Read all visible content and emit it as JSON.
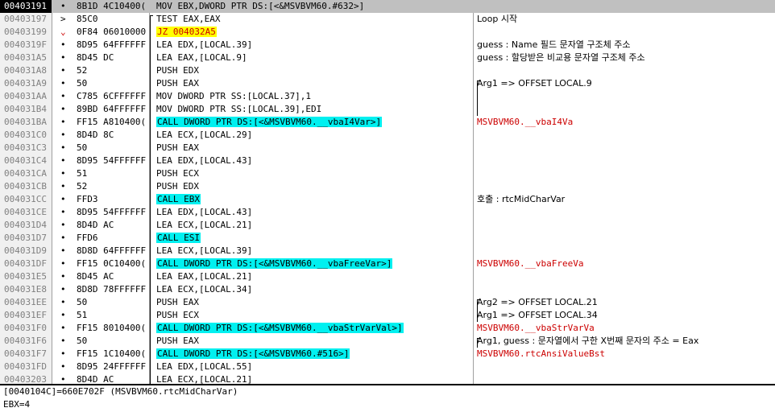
{
  "colors": {
    "highlight_call": "#00f0f0",
    "highlight_jump": "#ffff00",
    "jump_text": "#cc0000",
    "comment_red": "#cc0000",
    "selected_row": "#c0c0c0"
  },
  "rows": [
    {
      "addr": "00403191",
      "mark": "•",
      "bytes": "8B1D 4C10400(",
      "dis": "MOV EBX,DWORD PTR DS:[<&MSVBVM60.#632>]",
      "hl": "",
      "cmt": "",
      "cmt_red": false,
      "selected": true
    },
    {
      "addr": "00403197",
      "mark": ">",
      "bytes": "85C0",
      "dis": "TEST EAX,EAX",
      "hl": "",
      "cmt": "Loop 시작",
      "cmt_red": false
    },
    {
      "addr": "00403199",
      "mark": "⌄",
      "bytes": "0F84 06010000",
      "dis": "JZ 004032A5",
      "hl": "jump",
      "cmt": "",
      "cmt_red": false
    },
    {
      "addr": "0040319F",
      "mark": "•",
      "bytes": "8D95 64FFFFFF",
      "dis": "LEA EDX,[LOCAL.39]",
      "hl": "",
      "cmt": "guess : Name 필드 문자열 구조체 주소",
      "cmt_red": false
    },
    {
      "addr": "004031A5",
      "mark": "•",
      "bytes": "8D45 DC",
      "dis": "LEA EAX,[LOCAL.9]",
      "hl": "",
      "cmt": "guess : 할당받은 비교용 문자열 구조체 주소",
      "cmt_red": false
    },
    {
      "addr": "004031A8",
      "mark": "•",
      "bytes": "52",
      "dis": "PUSH EDX",
      "hl": "",
      "cmt": "",
      "cmt_red": false
    },
    {
      "addr": "004031A9",
      "mark": "•",
      "bytes": "50",
      "dis": "PUSH EAX",
      "hl": "",
      "cmt": "Arg1 => OFFSET LOCAL.9",
      "cmt_red": false
    },
    {
      "addr": "004031AA",
      "mark": "•",
      "bytes": "C785 6CFFFFFF",
      "dis": "MOV DWORD PTR SS:[LOCAL.37],1",
      "hl": "",
      "cmt": "",
      "cmt_red": false
    },
    {
      "addr": "004031B4",
      "mark": "•",
      "bytes": "89BD 64FFFFFF",
      "dis": "MOV DWORD PTR SS:[LOCAL.39],EDI",
      "hl": "",
      "cmt": "",
      "cmt_red": false
    },
    {
      "addr": "004031BA",
      "mark": "•",
      "bytes": "FF15 A810400(",
      "dis": "CALL DWORD PTR DS:[<&MSVBVM60.__vbaI4Var>]",
      "hl": "call",
      "cmt": "MSVBVM60.__vbaI4Va",
      "cmt_red": true
    },
    {
      "addr": "004031C0",
      "mark": "•",
      "bytes": "8D4D 8C",
      "dis": "LEA ECX,[LOCAL.29]",
      "hl": "",
      "cmt": "",
      "cmt_red": false
    },
    {
      "addr": "004031C3",
      "mark": "•",
      "bytes": "50",
      "dis": "PUSH EAX",
      "hl": "",
      "cmt": "",
      "cmt_red": false
    },
    {
      "addr": "004031C4",
      "mark": "•",
      "bytes": "8D95 54FFFFFF",
      "dis": "LEA EDX,[LOCAL.43]",
      "hl": "",
      "cmt": "",
      "cmt_red": false
    },
    {
      "addr": "004031CA",
      "mark": "•",
      "bytes": "51",
      "dis": "PUSH ECX",
      "hl": "",
      "cmt": "",
      "cmt_red": false
    },
    {
      "addr": "004031CB",
      "mark": "•",
      "bytes": "52",
      "dis": "PUSH EDX",
      "hl": "",
      "cmt": "",
      "cmt_red": false
    },
    {
      "addr": "004031CC",
      "mark": "•",
      "bytes": "FFD3",
      "dis": "CALL EBX",
      "hl": "call",
      "cmt": "호출 : rtcMidCharVar",
      "cmt_red": false
    },
    {
      "addr": "004031CE",
      "mark": "•",
      "bytes": "8D95 54FFFFFF",
      "dis": "LEA EDX,[LOCAL.43]",
      "hl": "",
      "cmt": "",
      "cmt_red": false
    },
    {
      "addr": "004031D4",
      "mark": "•",
      "bytes": "8D4D AC",
      "dis": "LEA ECX,[LOCAL.21]",
      "hl": "",
      "cmt": "",
      "cmt_red": false
    },
    {
      "addr": "004031D7",
      "mark": "•",
      "bytes": "FFD6",
      "dis": "CALL ESI",
      "hl": "call",
      "cmt": "",
      "cmt_red": false
    },
    {
      "addr": "004031D9",
      "mark": "•",
      "bytes": "8D8D 64FFFFFF",
      "dis": "LEA ECX,[LOCAL.39]",
      "hl": "",
      "cmt": "",
      "cmt_red": false
    },
    {
      "addr": "004031DF",
      "mark": "•",
      "bytes": "FF15 0C10400(",
      "dis": "CALL DWORD PTR DS:[<&MSVBVM60.__vbaFreeVar>]",
      "hl": "call",
      "cmt": "MSVBVM60.__vbaFreeVa",
      "cmt_red": true
    },
    {
      "addr": "004031E5",
      "mark": "•",
      "bytes": "8D45 AC",
      "dis": "LEA EAX,[LOCAL.21]",
      "hl": "",
      "cmt": "",
      "cmt_red": false
    },
    {
      "addr": "004031E8",
      "mark": "•",
      "bytes": "8D8D 78FFFFFF",
      "dis": "LEA ECX,[LOCAL.34]",
      "hl": "",
      "cmt": "",
      "cmt_red": false
    },
    {
      "addr": "004031EE",
      "mark": "•",
      "bytes": "50",
      "dis": "PUSH EAX",
      "hl": "",
      "cmt": "Arg2 => OFFSET LOCAL.21",
      "cmt_red": false
    },
    {
      "addr": "004031EF",
      "mark": "•",
      "bytes": "51",
      "dis": "PUSH ECX",
      "hl": "",
      "cmt": "Arg1 => OFFSET LOCAL.34",
      "cmt_red": false
    },
    {
      "addr": "004031F0",
      "mark": "•",
      "bytes": "FF15 8010400(",
      "dis": "CALL DWORD PTR DS:[<&MSVBVM60.__vbaStrVarVal>]",
      "hl": "call",
      "cmt": "MSVBVM60.__vbaStrVarVa",
      "cmt_red": true
    },
    {
      "addr": "004031F6",
      "mark": "•",
      "bytes": "50",
      "dis": "PUSH EAX",
      "hl": "",
      "cmt": "Arg1, guess : 문자열에서 구한 X번째 문자의 주소 = Eax",
      "cmt_red": false
    },
    {
      "addr": "004031F7",
      "mark": "•",
      "bytes": "FF15 1C10400(",
      "dis": "CALL DWORD PTR DS:[<&MSVBVM60.#516>]",
      "hl": "call",
      "cmt": "MSVBVM60.rtcAnsiValueBst",
      "cmt_red": true
    },
    {
      "addr": "004031FD",
      "mark": "•",
      "bytes": "8D95 24FFFFFF",
      "dis": "LEA EDX,[LOCAL.55]",
      "hl": "",
      "cmt": "",
      "cmt_red": false
    },
    {
      "addr": "00403203",
      "mark": "•",
      "bytes": "8D4D AC",
      "dis": "LEA ECX,[LOCAL.21]",
      "hl": "",
      "cmt": "",
      "cmt_red": false
    }
  ],
  "info": {
    "line1": "[0040104C]=660E702F (MSVBVM60.rtcMidCharVar)",
    "line2": "EBX=4"
  }
}
